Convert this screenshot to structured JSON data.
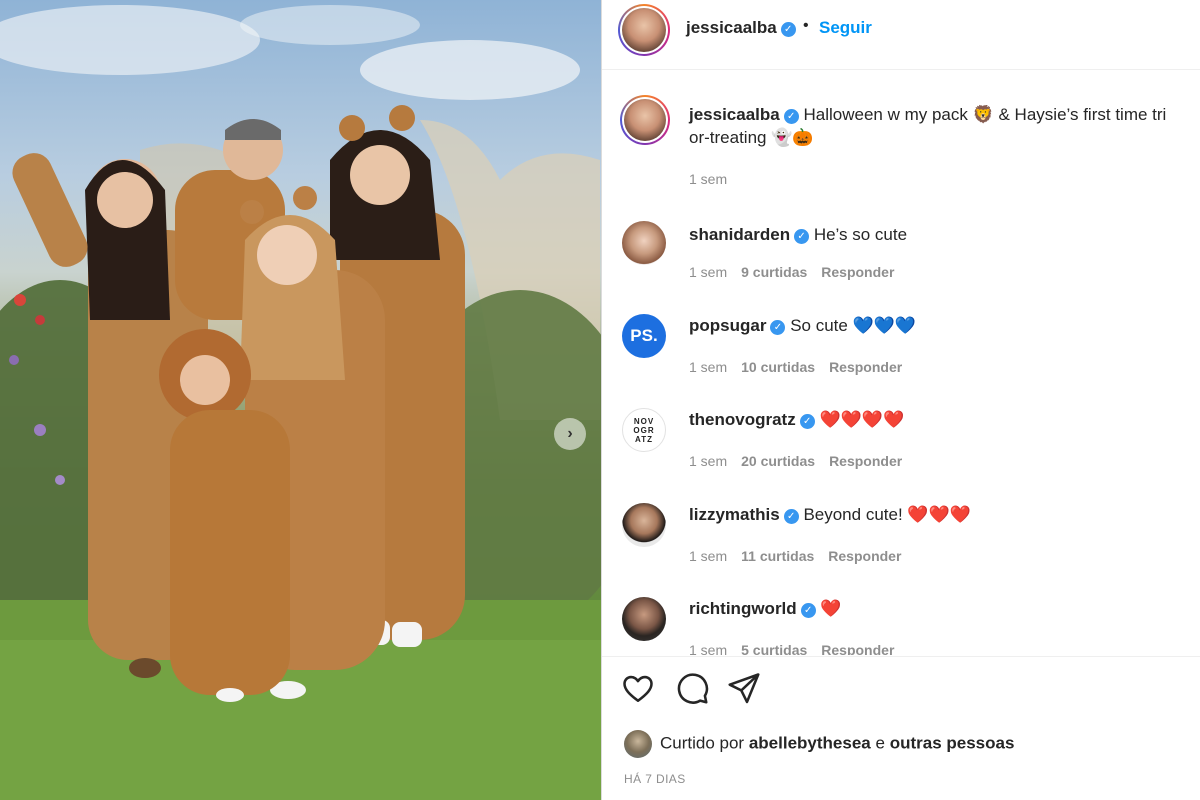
{
  "post": {
    "image_alt": "",
    "author": "jessicaalba",
    "follow_label": "Seguir",
    "dot": "•"
  },
  "caption": {
    "username": "jessicaalba",
    "line1": "Halloween w my pack 🦁 & Haysie’s first time tri",
    "line2": "or-treating 👻🎃",
    "time": "1 sem"
  },
  "comments": [
    {
      "username": "shanidarden",
      "verified": true,
      "text": "He’s so cute",
      "time": "1 sem",
      "likes": "9 curtidas",
      "reply": "Responder"
    },
    {
      "username": "popsugar",
      "verified": true,
      "text": "So cute",
      "hearts": "💙💙💙",
      "time": "1 sem",
      "likes": "10 curtidas",
      "reply": "Responder",
      "avatar_text": "PS."
    },
    {
      "username": "thenovogratz",
      "verified": true,
      "text": "",
      "hearts": "❤️❤️❤️❤️",
      "time": "1 sem",
      "likes": "20 curtidas",
      "reply": "Responder",
      "avatar_text": "NOV OGR ATZ"
    },
    {
      "username": "lizzymathis",
      "verified": true,
      "text": "Beyond cute!",
      "hearts": "❤️❤️❤️",
      "time": "1 sem",
      "likes": "11 curtidas",
      "reply": "Responder"
    },
    {
      "username": "richtingworld",
      "verified": true,
      "text": "",
      "hearts": "❤️",
      "time": "1 sem",
      "likes": "5 curtidas",
      "reply": "Responder"
    }
  ],
  "likes": {
    "prefix": "Curtido por",
    "user": "abellebythesea",
    "joiner": "e",
    "others": "outras pessoas"
  },
  "timestamp": "HÁ 7 DIAS",
  "icons": {
    "like": "heart-outline-icon",
    "comment": "speech-bubble-icon",
    "share": "paper-plane-icon",
    "verified": "verified-check-icon",
    "next": "chevron-right-icon"
  },
  "colors": {
    "link_blue": "#0095f6",
    "verified_blue": "#3897f0",
    "muted_gray": "#8e8e8e",
    "text": "#262626"
  }
}
